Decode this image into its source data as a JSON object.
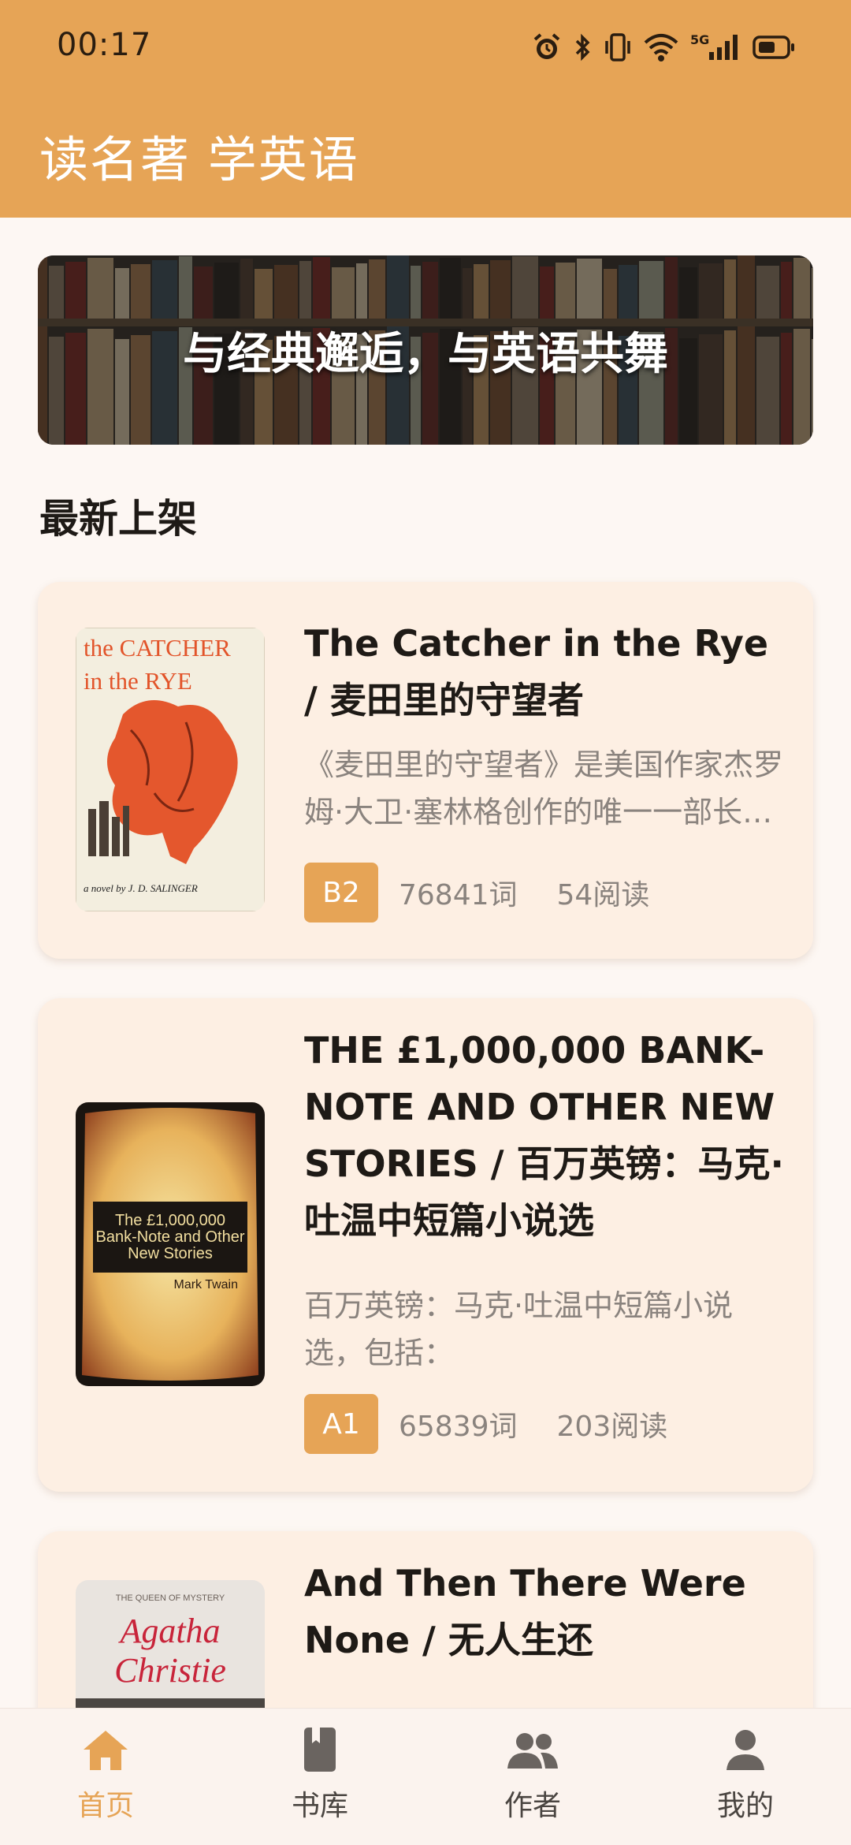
{
  "status_bar": {
    "time": "00:17",
    "icons": [
      "alarm-icon",
      "bluetooth-icon",
      "vibrate-icon",
      "wifi-icon",
      "5g-signal-icon",
      "battery-icon"
    ],
    "network_label": "5G"
  },
  "header": {
    "title": "读名著 学英语",
    "color": "#e6a456"
  },
  "banner": {
    "slogan": "与经典邂逅，与英语共舞"
  },
  "section": {
    "title": "最新上架"
  },
  "books": [
    {
      "title": "The Catcher in the Rye / 麦田里的守望者",
      "description": "《麦田里的守望者》是美国作家杰罗姆·大卫·塞林格创作的唯一一部长篇小说",
      "level": "B2",
      "words": "76841词",
      "reads": "54阅读",
      "cover": {
        "line1": "the CATCHER",
        "line2": "in the RYE",
        "author": "a novel by J. D. SALINGER"
      }
    },
    {
      "title": "THE £1,000,000 BANK-NOTE AND OTHER NEW STORIES / 百万英镑：马克·吐温中短篇小说选",
      "description": "百万英镑：马克·吐温中短篇小说选，包括：",
      "level": "A1",
      "words": "65839词",
      "reads": "203阅读",
      "cover": {
        "title": "The £1,000,000 Bank-Note and Other New Stories",
        "author": "Mark Twain"
      }
    },
    {
      "title": "And Then There Were None / 无人生还",
      "cover": {
        "top": "THE QUEEN OF MYSTERY",
        "author": "Agatha Christie"
      }
    }
  ],
  "tabbar": {
    "active_color": "#e6a456",
    "tabs": [
      {
        "label": "首页",
        "icon": "home-icon",
        "active": true
      },
      {
        "label": "书库",
        "icon": "book-icon",
        "active": false
      },
      {
        "label": "作者",
        "icon": "people-icon",
        "active": false
      },
      {
        "label": "我的",
        "icon": "person-icon",
        "active": false
      }
    ]
  }
}
